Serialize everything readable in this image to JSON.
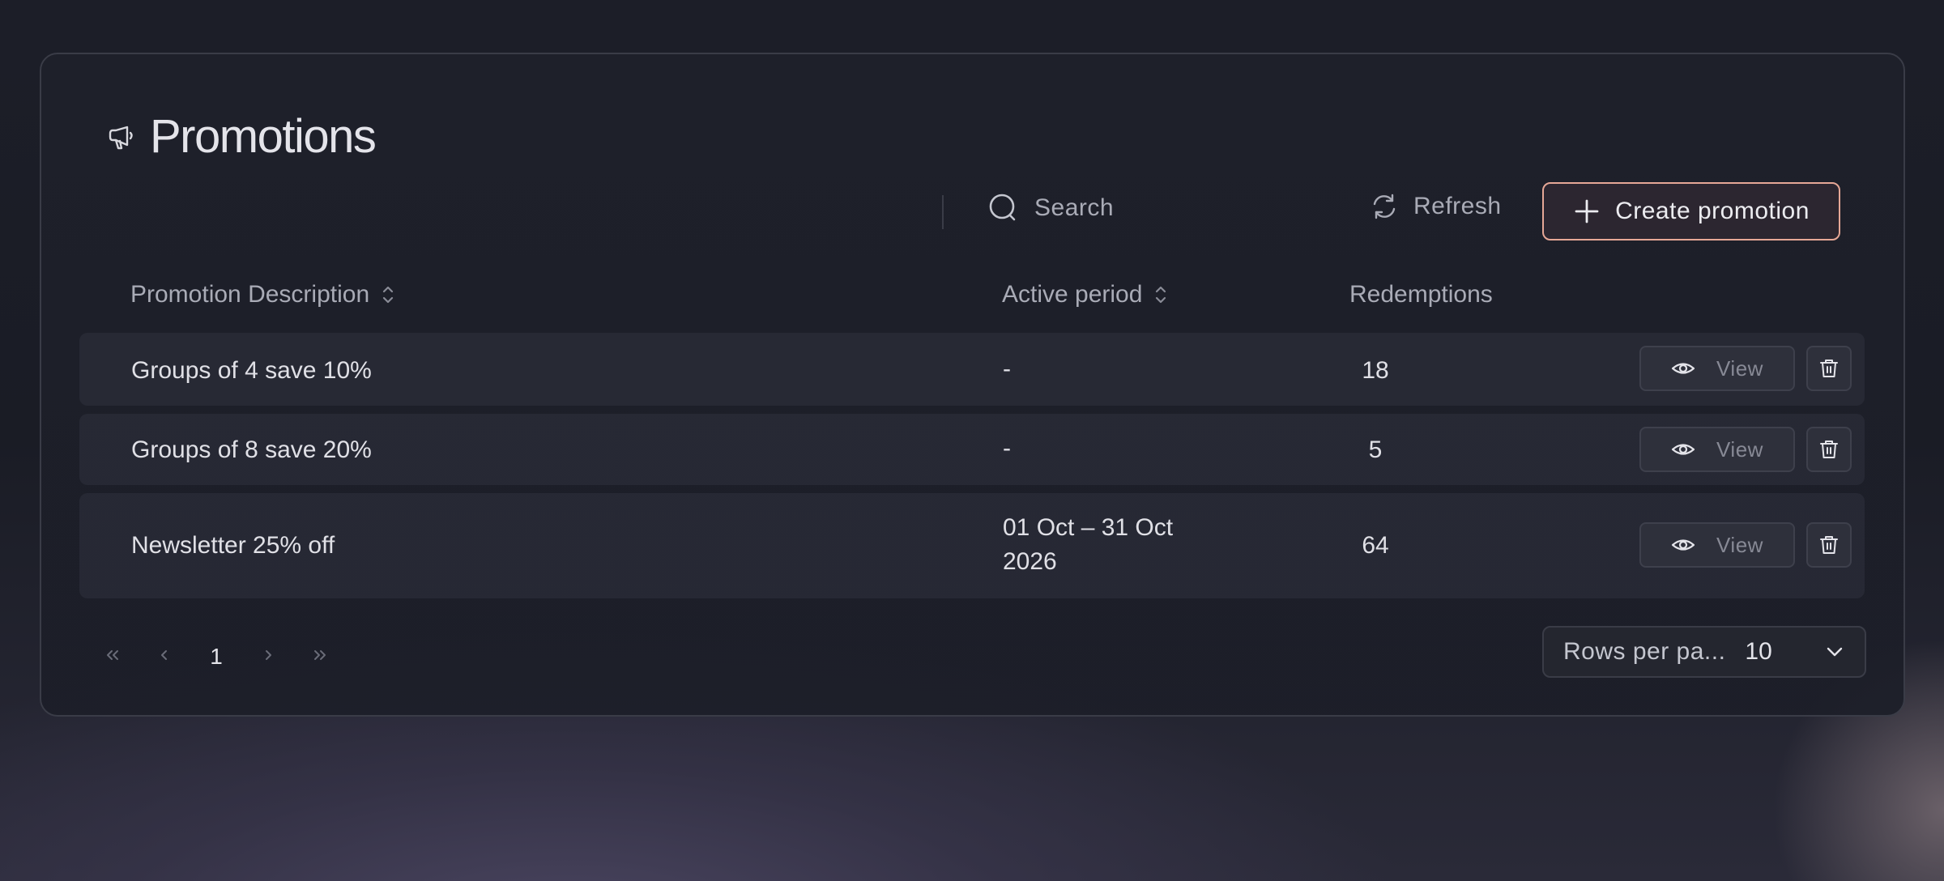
{
  "page": {
    "title": "Promotions"
  },
  "toolbar": {
    "search_placeholder": "Search",
    "refresh_label": "Refresh",
    "create_label": "Create promotion"
  },
  "table": {
    "columns": {
      "description": "Promotion Description",
      "period": "Active period",
      "redemptions": "Redemptions"
    },
    "view_label": "View",
    "rows": [
      {
        "description": "Groups of 4 save 10%",
        "period_line1": "-",
        "period_line2": "",
        "redemptions": "18"
      },
      {
        "description": "Groups of 8 save 20%",
        "period_line1": "-",
        "period_line2": "",
        "redemptions": "5"
      },
      {
        "description": "Newsletter 25% off",
        "period_line1": "01 Oct – 31 Oct",
        "period_line2": "2026",
        "redemptions": "64"
      }
    ]
  },
  "pagination": {
    "current_page": "1",
    "rows_per_page_label": "Rows per pa...",
    "rows_per_page_value": "10"
  },
  "colors": {
    "accent_border": "#e6a796",
    "card_border": "#3a3c47"
  }
}
